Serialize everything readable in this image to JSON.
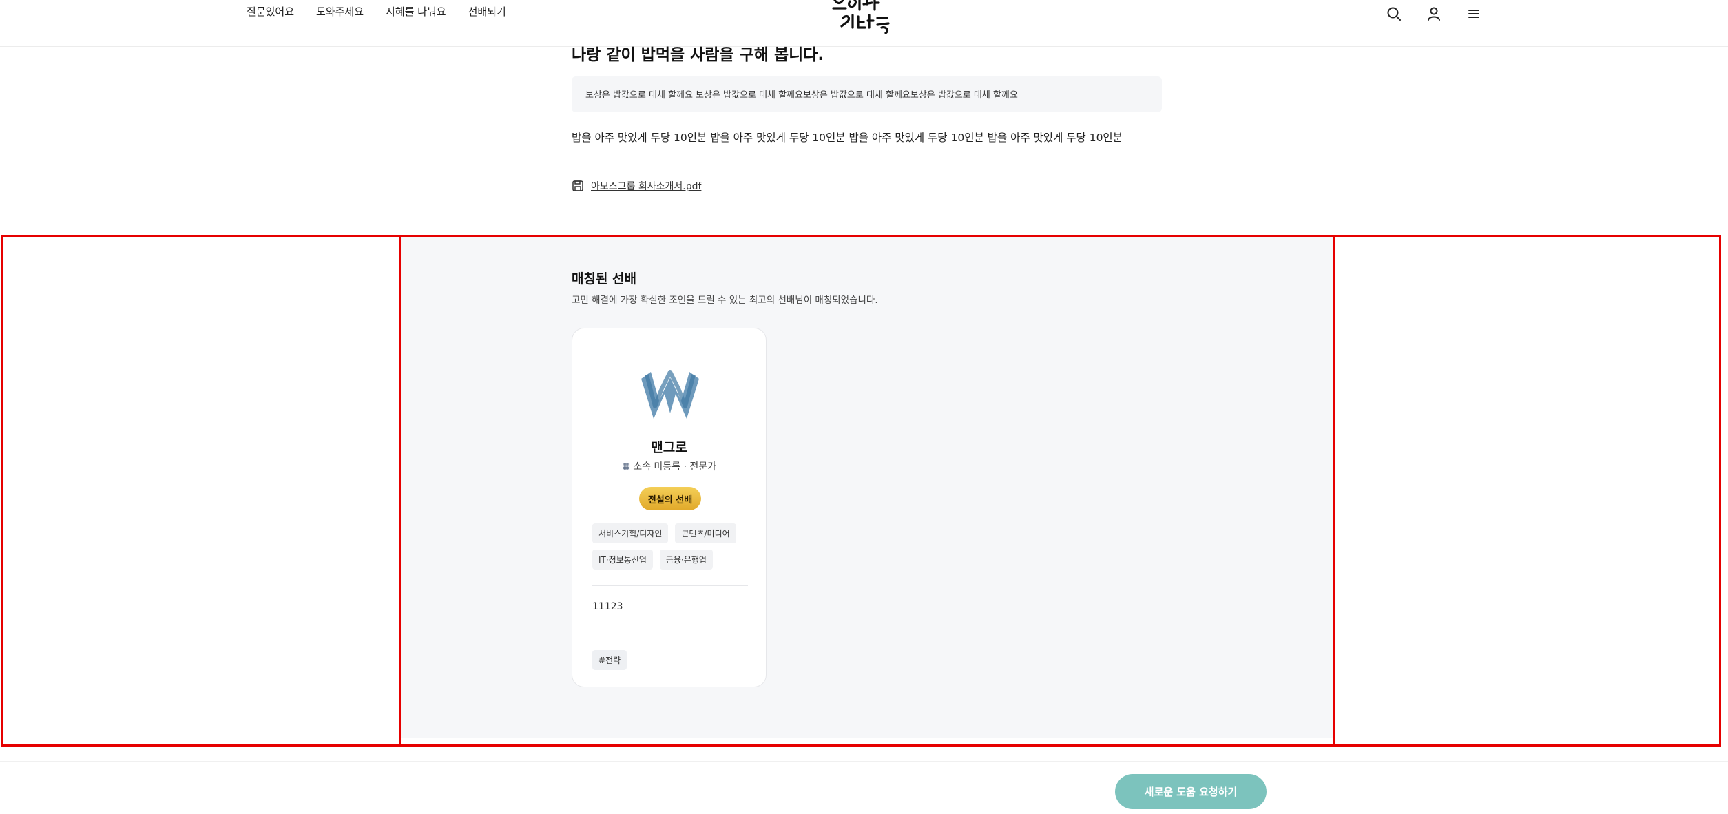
{
  "header": {
    "nav": [
      "질문있어요",
      "도와주세요",
      "지혜를 나눠요",
      "선배되기"
    ],
    "icons": [
      "search-icon",
      "user-icon",
      "menu-icon"
    ]
  },
  "post": {
    "title": "나랑 같이 밥먹을 사람을 구해 봅니다.",
    "reward": "보상은 밥값으로 대체 할께요 보상은 밥값으로 대체 할께요보상은 밥값으로 대체 할께요보상은 밥값으로 대체 할께요",
    "body": "밥을 아주 맛있게 두당 10인분 밥을 아주 맛있게 두당 10인분 밥을 아주 맛있게 두당 10인분 밥을 아주 맛있게 두당 10인분",
    "attachment": "아모스그룹 회사소개서.pdf"
  },
  "matched": {
    "title": "매칭된 선배",
    "description": "고민 해결에 가장 확실한 조언을 드릴 수 있는 최고의 선배님이 매칭되었습니다.",
    "card": {
      "name": "맨그로",
      "affiliation": "소속 미등록 · 전문가",
      "badge": "전설의 선배",
      "tags": [
        "서비스기획/디자인",
        "콘텐츠/미디어",
        "IT·정보통신업",
        "금융·은행업"
      ],
      "text": "11123",
      "hashtag": "#전략"
    }
  },
  "cta": {
    "label": "새로운 도움 요청하기"
  },
  "colors": {
    "accent": "#7cc3bd",
    "badge": "#e8b83a",
    "highlight": "#e60000",
    "section_bg": "#f6f7f9"
  }
}
